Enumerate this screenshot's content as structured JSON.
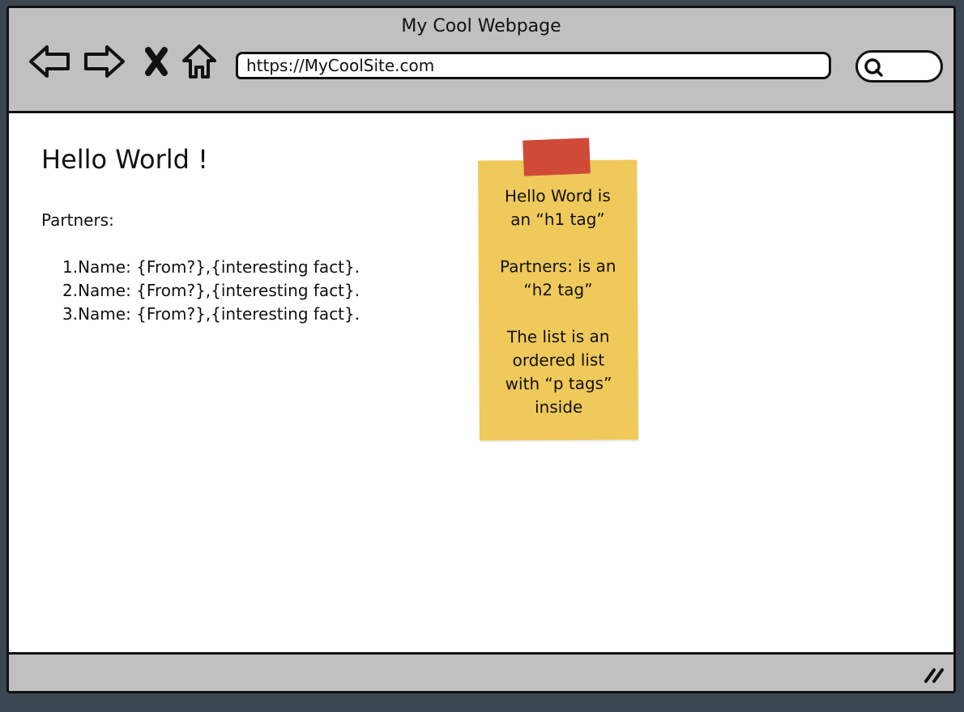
{
  "window": {
    "title": "My Cool Webpage"
  },
  "toolbar": {
    "back_icon": "arrow-left-icon",
    "forward_icon": "arrow-right-icon",
    "stop_icon": "close-icon",
    "home_icon": "home-icon",
    "url": "https://MyCoolSite.com",
    "search_icon": "search-icon"
  },
  "page": {
    "h1": "Hello World !",
    "h2": "Partners:",
    "list": [
      "1.Name: {From?},{interesting fact}.",
      "2.Name: {From?},{interesting fact}.",
      "3.Name: {From?},{interesting fact}."
    ]
  },
  "sticky_note": {
    "text": "Hello Word is\nan “h1 tag”\n\nPartners: is an\n“h2 tag”\n\nThe list is an\nordered list\nwith “p tags”\ninside"
  },
  "colors": {
    "chrome": "#c0c0c0",
    "sticky": "#efc95a",
    "tape": "#d04a38",
    "outer": "#3b4650"
  }
}
